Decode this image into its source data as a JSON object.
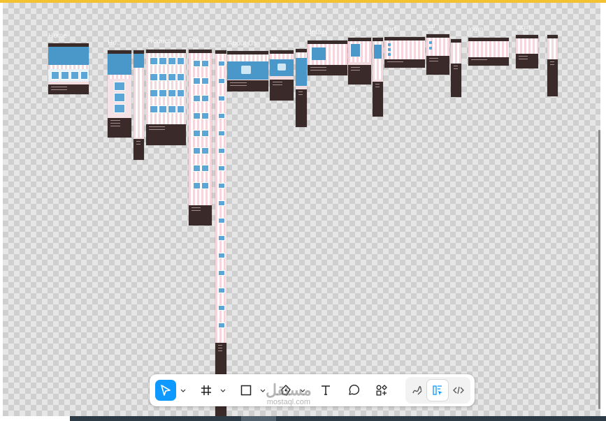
{
  "accent_color": "#0d99ff",
  "frames": [
    {
      "label": "Home"
    },
    {
      "label": "Ho..."
    },
    {
      "label": "Products"
    },
    {
      "label": "Pro..."
    },
    {
      "label": "..."
    },
    {
      "label": "About Us"
    },
    {
      "label": "Ab..."
    },
    {
      "label": "details"
    },
    {
      "label": "det..."
    },
    {
      "label": "cart"
    },
    {
      "label": "car"
    },
    {
      "label": "login"
    },
    {
      "label": "login"
    }
  ],
  "toolbar": {
    "tools": [
      {
        "name": "move",
        "icon": "cursor-icon",
        "active": true
      },
      {
        "name": "frame",
        "icon": "frame-hash-icon"
      },
      {
        "name": "rectangle",
        "icon": "square-icon"
      },
      {
        "name": "pen",
        "icon": "pen-icon"
      },
      {
        "name": "text",
        "icon": "text-icon"
      },
      {
        "name": "comment",
        "icon": "comment-icon"
      },
      {
        "name": "actions",
        "icon": "shapes-plus-icon"
      }
    ],
    "mode_tools": [
      {
        "name": "draw",
        "icon": "draw-icon"
      },
      {
        "name": "design",
        "icon": "design-mode-icon",
        "selected": true
      },
      {
        "name": "dev",
        "icon": "code-icon"
      }
    ]
  },
  "watermark": {
    "arabic": "مستقل",
    "latin": "mostaql.com"
  }
}
